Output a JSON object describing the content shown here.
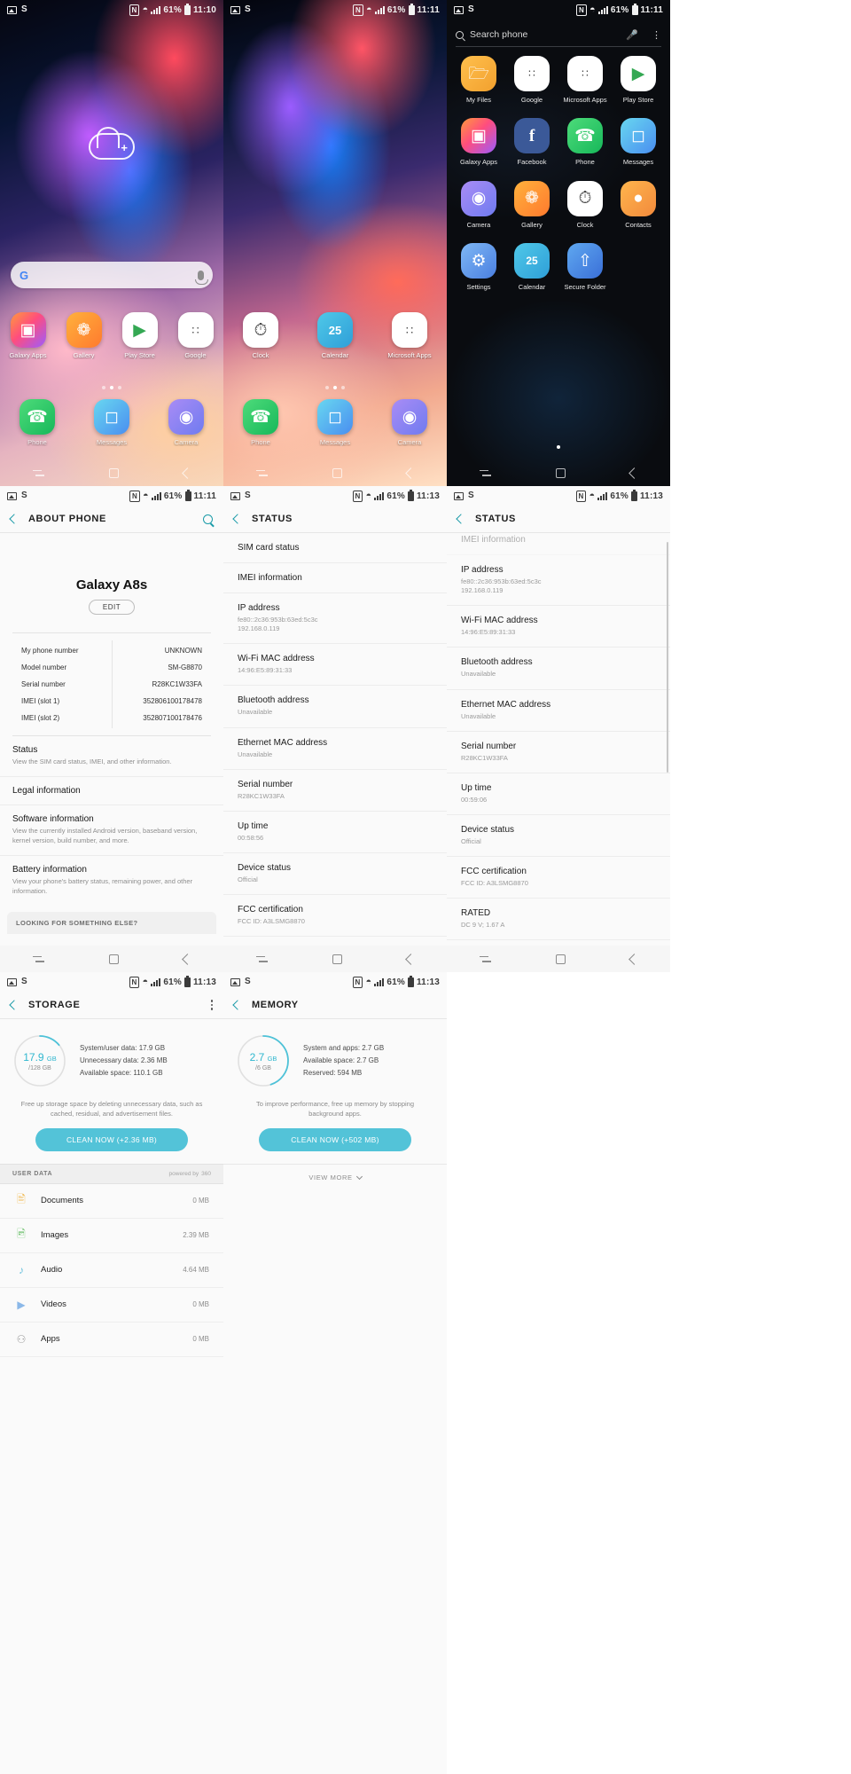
{
  "statusbar": {
    "left_icons": [
      "image-icon",
      "s-icon"
    ],
    "s_label": "S",
    "right_icons": [
      "nfc-icon",
      "wifi-icon",
      "signal-icon",
      "battery-icon"
    ],
    "nfc_label": "N",
    "battery_percent": "61%",
    "times": {
      "t1": "11:10",
      "t2": "11:11",
      "t3": "11:11",
      "t4": "11:11",
      "t5": "11:13",
      "t6": "11:13",
      "t7": "11:13",
      "t8": "11:13"
    }
  },
  "home1": {
    "widget": {
      "name": "cloud-widget",
      "plus": "+"
    },
    "search": {
      "logo": "G",
      "placeholder": "",
      "mic": "mic-icon"
    },
    "row1": [
      {
        "label": "Galaxy Apps",
        "icon": "galaxy-apps-icon",
        "cls": "ic-galaxyapps",
        "glyph": "◯"
      },
      {
        "label": "Gallery",
        "icon": "gallery-icon",
        "cls": "ic-gallery",
        "glyph": "✱"
      },
      {
        "label": "Play Store",
        "icon": "play-store-icon",
        "cls": "ic-playstore",
        "glyph": "▶"
      },
      {
        "label": "Google",
        "icon": "google-folder-icon",
        "cls": "ic-google",
        "glyph": "∷"
      }
    ],
    "row2": [
      {
        "label": "Phone",
        "icon": "phone-icon",
        "cls": "ic-phone",
        "glyph": "✆"
      },
      {
        "label": "Messages",
        "icon": "messages-icon",
        "cls": "ic-messages",
        "glyph": "▭"
      },
      {
        "label": "Camera",
        "icon": "camera-icon",
        "cls": "ic-camera",
        "glyph": "◎"
      }
    ],
    "dots": 3,
    "active_dot": 1,
    "nav": [
      "recent-apps-icon",
      "home-icon",
      "back-icon"
    ]
  },
  "home2": {
    "row1": [
      {
        "label": "Clock",
        "icon": "clock-icon",
        "cls": "ic-clock",
        "glyph": "◴"
      },
      {
        "label": "Calendar",
        "icon": "calendar-icon",
        "cls": "ic-calendar",
        "glyph": "25"
      },
      {
        "label": "Microsoft Apps",
        "icon": "microsoft-apps-icon",
        "cls": "ic-msapps",
        "glyph": "∷"
      }
    ],
    "row2": [
      {
        "label": "Phone",
        "icon": "phone-icon",
        "cls": "ic-phone",
        "glyph": "✆"
      },
      {
        "label": "Messages",
        "icon": "messages-icon",
        "cls": "ic-messages",
        "glyph": "▭"
      },
      {
        "label": "Camera",
        "icon": "camera-icon",
        "cls": "ic-camera",
        "glyph": "◎"
      }
    ],
    "dots": 3,
    "active_dot": 1
  },
  "drawer": {
    "search_placeholder": "Search phone",
    "search_icon": "search-icon",
    "mic_icon": "mic-icon",
    "menu_icon": "overflow-menu-icon",
    "rows": [
      [
        {
          "label": "My Files",
          "icon": "my-files-icon",
          "cls": "ic-myfiles",
          "glyph": "὜0"
        },
        {
          "label": "Google",
          "icon": "google-folder-icon",
          "cls": "ic-google",
          "glyph": "∷"
        },
        {
          "label": "Microsoft Apps",
          "icon": "microsoft-apps-icon",
          "cls": "ic-msapps",
          "glyph": "∷"
        },
        {
          "label": "Play Store",
          "icon": "play-store-icon",
          "cls": "ic-playstore",
          "glyph": "▶"
        }
      ],
      [
        {
          "label": "Galaxy Apps",
          "icon": "galaxy-apps-icon",
          "cls": "ic-galaxyapps",
          "glyph": "◯"
        },
        {
          "label": "Facebook",
          "icon": "facebook-icon",
          "cls": "ic-facebook",
          "glyph": "f"
        },
        {
          "label": "Phone",
          "icon": "phone-icon",
          "cls": "ic-phone",
          "glyph": "✆"
        },
        {
          "label": "Messages",
          "icon": "messages-icon",
          "cls": "ic-messages",
          "glyph": "▭"
        }
      ],
      [
        {
          "label": "Camera",
          "icon": "camera-icon",
          "cls": "ic-camera",
          "glyph": "◎"
        },
        {
          "label": "Gallery",
          "icon": "gallery-icon",
          "cls": "ic-gallery",
          "glyph": "✱"
        },
        {
          "label": "Clock",
          "icon": "clock-icon",
          "cls": "ic-clock",
          "glyph": "◴"
        },
        {
          "label": "Contacts",
          "icon": "contacts-icon",
          "cls": "ic-contacts",
          "glyph": "●"
        }
      ],
      [
        {
          "label": "Settings",
          "icon": "settings-icon",
          "cls": "ic-settings",
          "glyph": "⚙"
        },
        {
          "label": "Calendar",
          "icon": "calendar-icon",
          "cls": "ic-calendar",
          "glyph": "25"
        },
        {
          "label": "Secure Folder",
          "icon": "secure-folder-icon",
          "cls": "ic-securefolder",
          "glyph": "↑"
        }
      ]
    ]
  },
  "about": {
    "title": "ABOUT PHONE",
    "search_icon": "search-icon",
    "back_icon": "back-icon",
    "device_name": "Galaxy A8s",
    "edit_label": "EDIT",
    "info": [
      {
        "key": "My phone number",
        "value": "UNKNOWN"
      },
      {
        "key": "Model number",
        "value": "SM-G8870"
      },
      {
        "key": "Serial number",
        "value": "R28KC1W33FA"
      },
      {
        "key": "IMEI (slot 1)",
        "value": "352806100178478"
      },
      {
        "key": "IMEI (slot 2)",
        "value": "352807100178476"
      }
    ],
    "items": [
      {
        "title": "Status",
        "sub": "View the SIM card status, IMEI, and other information."
      },
      {
        "title": "Legal information",
        "sub": ""
      },
      {
        "title": "Software information",
        "sub": "View the currently installed Android version, baseband version, kernel version, build number, and more."
      },
      {
        "title": "Battery information",
        "sub": "View your phone's battery status, remaining power, and other information."
      }
    ],
    "footer": "LOOKING FOR SOMETHING ELSE?"
  },
  "status_mid": {
    "title": "STATUS",
    "back_icon": "back-icon",
    "items": [
      {
        "title": "SIM card status",
        "value": ""
      },
      {
        "title": "IMEI information",
        "value": ""
      },
      {
        "title": "IP address",
        "value": "fe80::2c36:953b:63ed:5c3c\n192.168.0.119"
      },
      {
        "title": "Wi-Fi MAC address",
        "value": "14:96:E5:89:31:33"
      },
      {
        "title": "Bluetooth address",
        "value": "Unavailable"
      },
      {
        "title": "Ethernet MAC address",
        "value": "Unavailable"
      },
      {
        "title": "Serial number",
        "value": "R28KC1W33FA"
      },
      {
        "title": "Up time",
        "value": "00:58:56"
      },
      {
        "title": "Device status",
        "value": "Official"
      },
      {
        "title": "FCC certification",
        "value": "FCC ID: A3LSMG8870"
      }
    ]
  },
  "status_right": {
    "title": "STATUS",
    "back_icon": "back-icon",
    "partial_top": "IMEI information",
    "items": [
      {
        "title": "IP address",
        "value": "fe80::2c36:953b:63ed:5c3c\n192.168.0.119"
      },
      {
        "title": "Wi-Fi MAC address",
        "value": "14:96:E5:89:31:33"
      },
      {
        "title": "Bluetooth address",
        "value": "Unavailable"
      },
      {
        "title": "Ethernet MAC address",
        "value": "Unavailable"
      },
      {
        "title": "Serial number",
        "value": "R28KC1W33FA"
      },
      {
        "title": "Up time",
        "value": "00:59:06"
      },
      {
        "title": "Device status",
        "value": "Official"
      },
      {
        "title": "FCC certification",
        "value": "FCC ID: A3LSMG8870"
      },
      {
        "title": "RATED",
        "value": "DC 9 V; 1.67 A"
      }
    ]
  },
  "storage": {
    "title": "STORAGE",
    "back_icon": "back-icon",
    "menu_icon": "overflow-menu-icon",
    "ring_value": "17.9",
    "ring_unit": "GB",
    "ring_total": "/128 GB",
    "ring_percent": 14,
    "lines": [
      "System/user data: 17.9 GB",
      "Unnecessary data: 2.36 MB",
      "Available space: 110.1 GB"
    ],
    "description": "Free up storage space by deleting unnecessary data, such as cached, residual, and advertisement files.",
    "clean_button": "CLEAN NOW (+2.36 MB)",
    "userdata_label": "USER DATA",
    "powered_by": "powered by",
    "powered_brand": "360",
    "rows": [
      {
        "name": "Documents",
        "size": "0 MB",
        "icon": "document-icon"
      },
      {
        "name": "Images",
        "size": "2.39 MB",
        "icon": "image-icon"
      },
      {
        "name": "Audio",
        "size": "4.64 MB",
        "icon": "audio-icon"
      },
      {
        "name": "Videos",
        "size": "0 MB",
        "icon": "video-icon"
      },
      {
        "name": "Apps",
        "size": "0 MB",
        "icon": "apps-icon"
      }
    ]
  },
  "memory": {
    "title": "MEMORY",
    "back_icon": "back-icon",
    "ring_value": "2.7",
    "ring_unit": "GB",
    "ring_total": "/6 GB",
    "ring_percent": 45,
    "lines": [
      "System and apps: 2.7 GB",
      "Available space: 2.7 GB",
      "Reserved: 594 MB"
    ],
    "description": "To improve performance, free up memory by stopping background apps.",
    "clean_button": "CLEAN NOW (+502 MB)",
    "view_more": "VIEW MORE"
  },
  "colors": {
    "accent_teal": "#1a9ba8",
    "button_blue": "#53c3d8",
    "ring_blue": "#2fb7cf"
  }
}
